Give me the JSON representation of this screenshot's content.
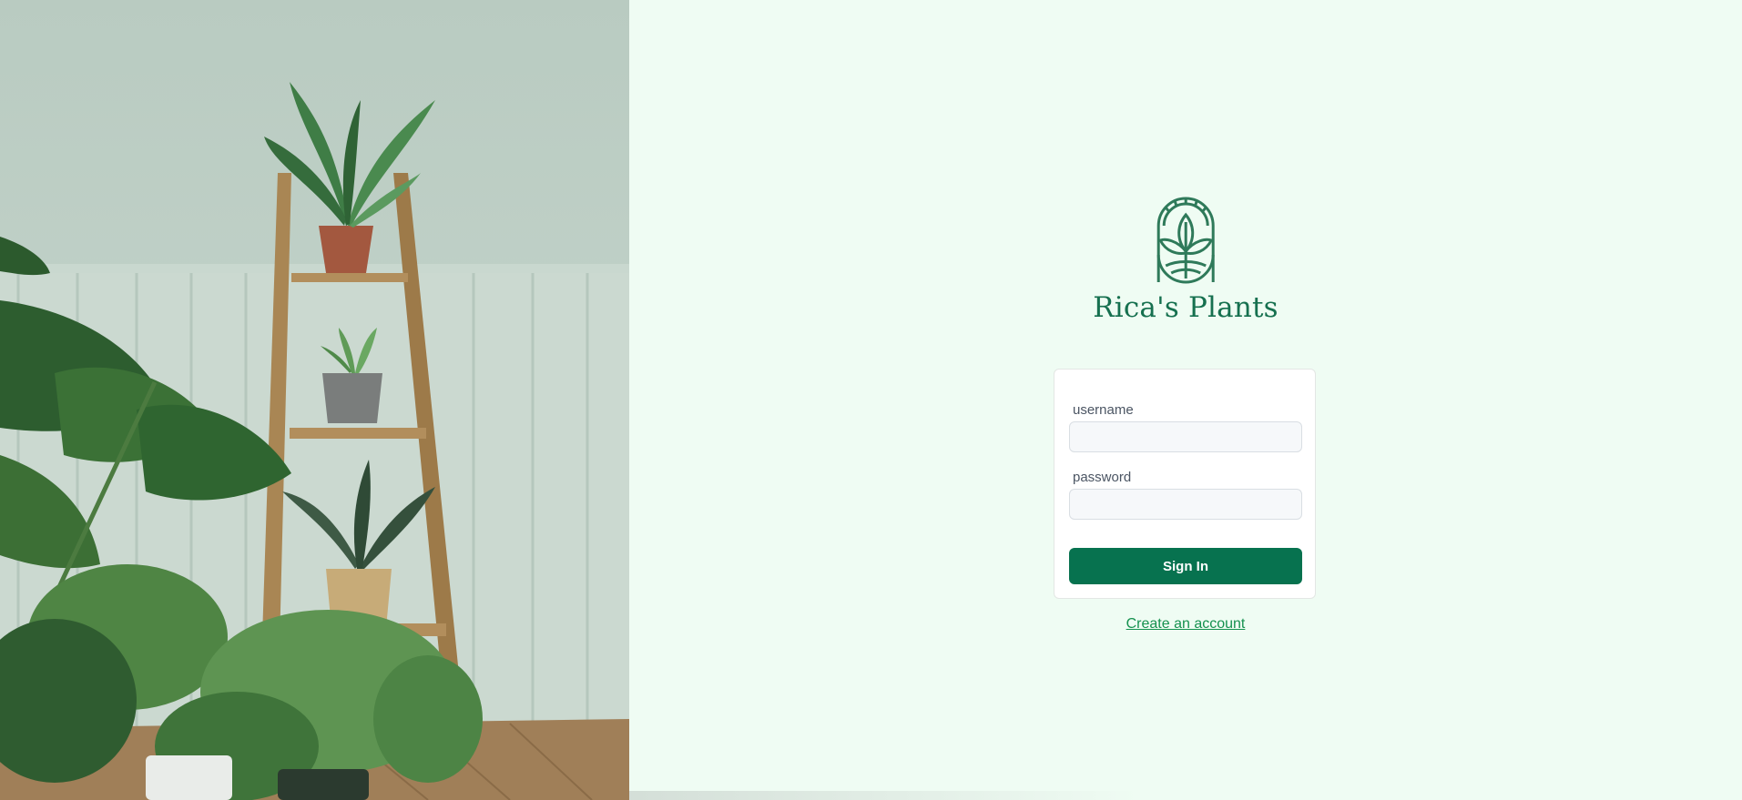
{
  "brand": {
    "name": "Rica's Plants",
    "logo_icon": "plant-arch-logo-icon",
    "color": "#16704f"
  },
  "hero": {
    "image": "potted-plants-on-wooden-ladder-shelf"
  },
  "login_form": {
    "username_label": "username",
    "username_value": "",
    "password_label": "password",
    "password_value": "",
    "submit_label": "Sign In",
    "submit_color": "#07724f"
  },
  "create_account_link": "Create an account",
  "colors": {
    "background": "#effcf3",
    "link": "#15914f"
  }
}
